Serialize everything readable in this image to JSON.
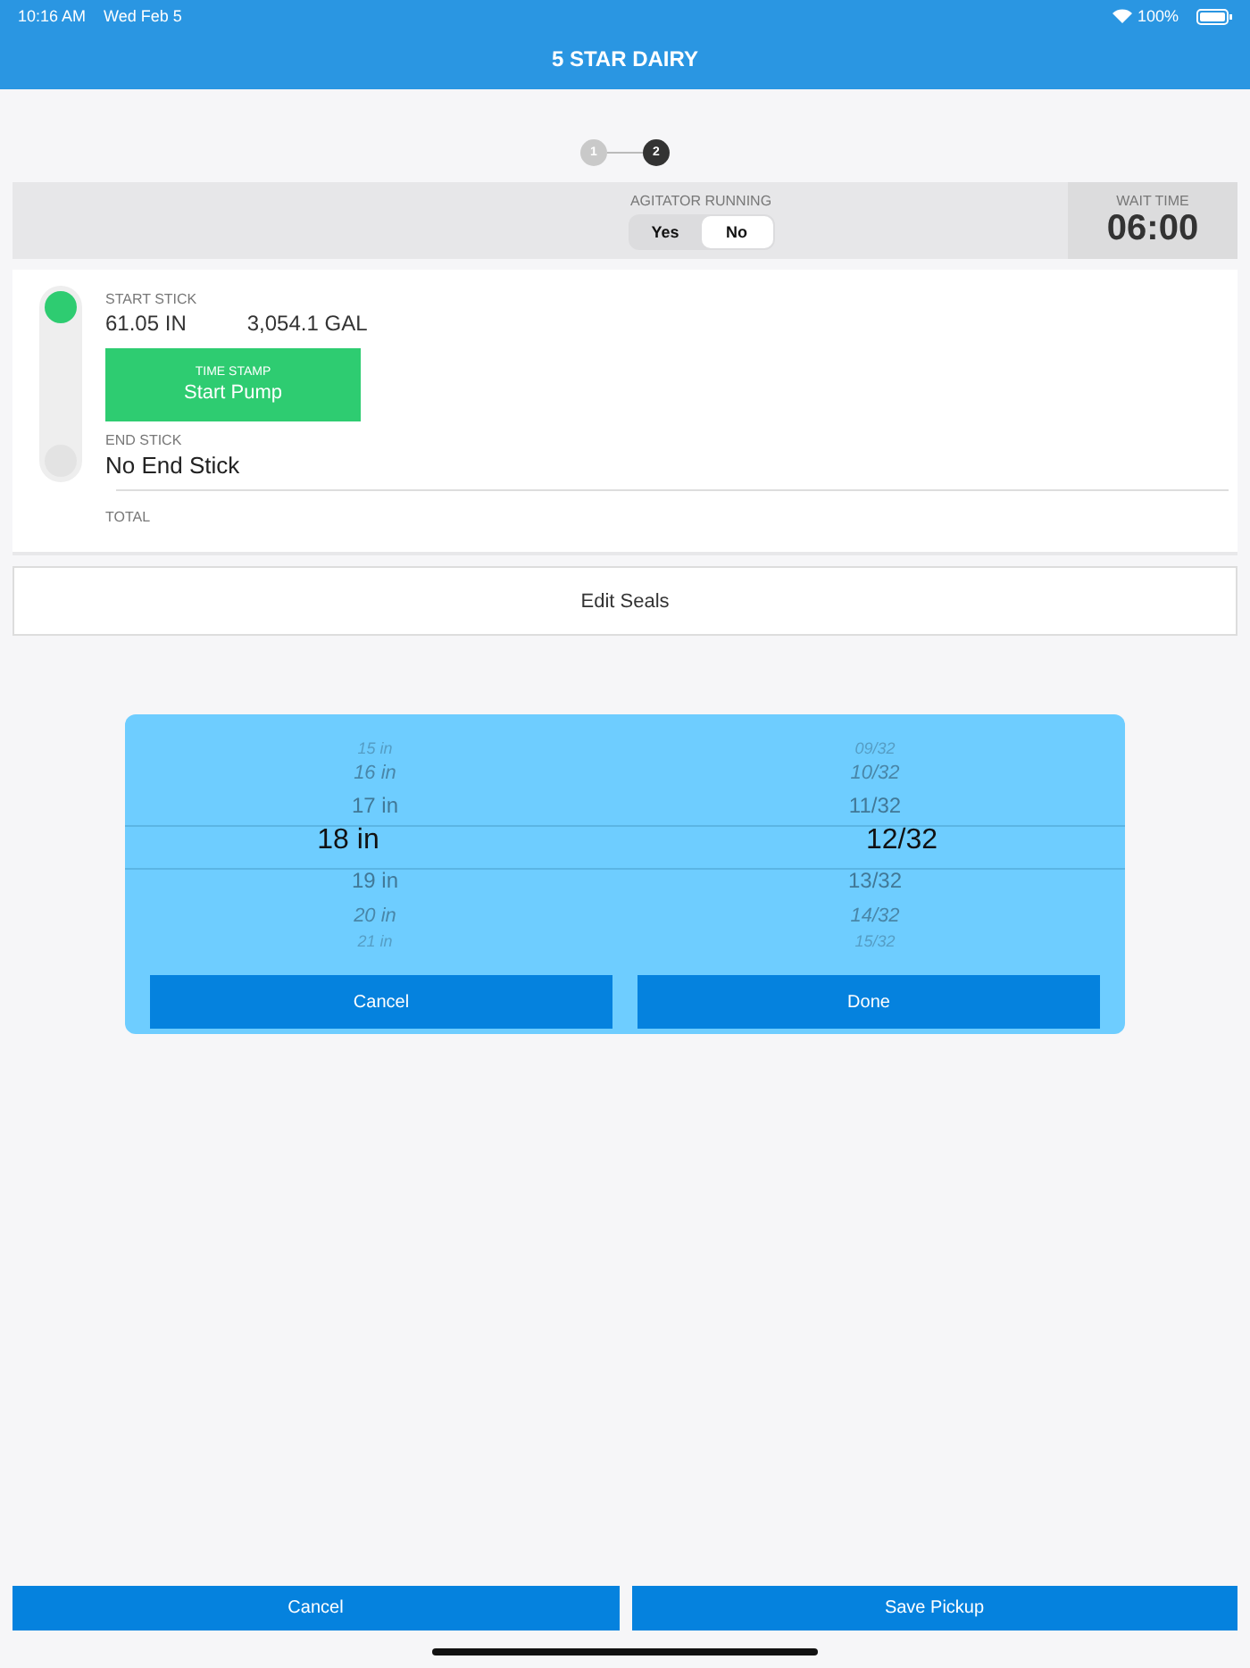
{
  "status_bar": {
    "time": "10:16 AM",
    "date": "Wed Feb 5",
    "battery": "100%"
  },
  "header": {
    "title": "5 STAR DAIRY"
  },
  "steps": [
    {
      "label": "1",
      "selected": false
    },
    {
      "label": "2",
      "selected": true
    }
  ],
  "agitator": {
    "label": "AGITATOR RUNNING",
    "options": [
      {
        "label": "Yes",
        "selected": false
      },
      {
        "label": "No",
        "selected": true
      }
    ]
  },
  "wait_time": {
    "label": "WAIT TIME",
    "value": "06:00"
  },
  "start_stick": {
    "label": "START STICK",
    "inches": "61.05 IN",
    "gallons": "3,054.1 GAL"
  },
  "timestamp_button": {
    "caption": "TIME STAMP",
    "label": "Start Pump"
  },
  "end_stick": {
    "label": "END STICK",
    "value": "No End Stick"
  },
  "total": {
    "label": "TOTAL"
  },
  "edit_seals": "Edit Seals",
  "picker": {
    "columns": [
      {
        "items": [
          {
            "label": "15 in",
            "selected": false
          },
          {
            "label": "16 in",
            "selected": false
          },
          {
            "label": "17 in",
            "selected": false
          },
          {
            "label": "18 in",
            "selected": true
          },
          {
            "label": "19 in",
            "selected": false
          },
          {
            "label": "20 in",
            "selected": false
          },
          {
            "label": "21 in",
            "selected": false
          }
        ]
      },
      {
        "items": [
          {
            "label": "09/32",
            "selected": false
          },
          {
            "label": "10/32",
            "selected": false
          },
          {
            "label": "11/32",
            "selected": false
          },
          {
            "label": "12/32",
            "selected": true
          },
          {
            "label": "13/32",
            "selected": false
          },
          {
            "label": "14/32",
            "selected": false
          },
          {
            "label": "15/32",
            "selected": false
          }
        ]
      }
    ],
    "buttons": [
      "Cancel",
      "Done"
    ]
  },
  "footer_buttons": [
    "Cancel",
    "Save Pickup"
  ]
}
